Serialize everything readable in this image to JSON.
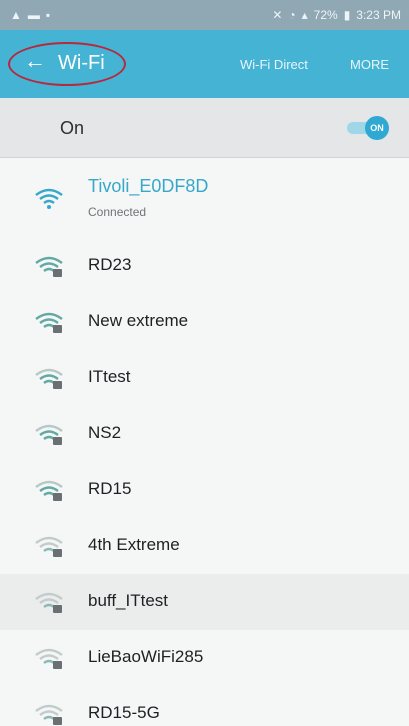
{
  "status_bar": {
    "battery": "72%",
    "time": "3:23 PM"
  },
  "app_bar": {
    "title": "Wi-Fi",
    "wifi_direct_label": "Wi-Fi Direct",
    "more_label": "MORE"
  },
  "master_toggle": {
    "label": "On",
    "state_label": "ON"
  },
  "networks": [
    {
      "name": "Tivoli_E0DF8D",
      "status": "Connected"
    },
    {
      "name": "RD23"
    },
    {
      "name": "New extreme"
    },
    {
      "name": "ITtest"
    },
    {
      "name": "NS2"
    },
    {
      "name": "RD15"
    },
    {
      "name": "4th Extreme"
    },
    {
      "name": "buff_ITtest"
    },
    {
      "name": "LieBaoWiFi285"
    },
    {
      "name": "RD15-5G"
    }
  ],
  "colors": {
    "accent": "#44b3d4",
    "connected_text": "#37a8c9",
    "highlight_circle": "#b52a3e"
  }
}
